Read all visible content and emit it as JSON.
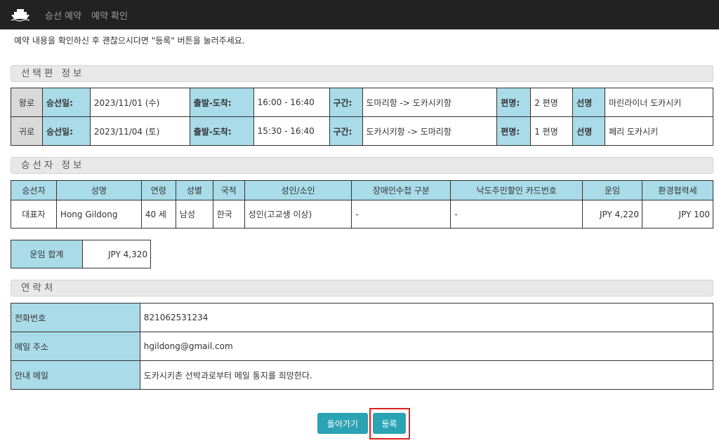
{
  "nav": {
    "items": [
      "승선 예약",
      "예약 확인"
    ]
  },
  "intro": "예약 내용을 확인하신 후 괜찮으시다면 \"등록\" 버튼을 눌러주세요.",
  "sections": {
    "trip": "선택편 정보",
    "passengers": "승선자 정보",
    "contact": "연락처"
  },
  "trips": [
    {
      "dir": "왕로",
      "date_label": "승선일:",
      "date": "2023/11/01 (수)",
      "time_label": "출발-도착:",
      "time": "16:00 - 16:40",
      "route_label": "구간:",
      "route": "도마리항 -> 도카시키항",
      "count_label": "편명:",
      "count": "2 편명",
      "ship_label": "선명",
      "ship": "마린라이너 도카시키"
    },
    {
      "dir": "귀로",
      "date_label": "승선일:",
      "date": "2023/11/04 (토)",
      "time_label": "출발-도착:",
      "time": "15:30 - 16:40",
      "route_label": "구간:",
      "route": "도카시키항 -> 도마리항",
      "count_label": "편명:",
      "count": "1 편명",
      "ship_label": "선명",
      "ship": "페리 도카시키"
    }
  ],
  "passenger_table": {
    "headers": [
      "승선자",
      "성명",
      "연령",
      "성별",
      "국적",
      "성인/소인",
      "장애인수첩 구분",
      "낙도주민할인 카드번호",
      "운임",
      "환경협력세"
    ],
    "rows": [
      [
        "대표자",
        "Hong Gildong",
        "40 세",
        "남성",
        "한국",
        "성인(고교생 이상)",
        "-",
        "-",
        "JPY 4,220",
        "JPY 100"
      ]
    ]
  },
  "total": {
    "label": "운임 합계",
    "value": "JPY 4,320"
  },
  "contact": [
    {
      "label": "전화번호",
      "value": "821062531234"
    },
    {
      "label": "메일 주소",
      "value": "hgildong@gmail.com"
    },
    {
      "label": "안내 메일",
      "value": "도카시키촌 선박과로부터 메일 통지를 희망한다."
    }
  ],
  "buttons": {
    "back": "돌아가기",
    "register": "등록"
  },
  "colors": {
    "accent": "#2aa3b4",
    "label_bg": "#a9dbe8",
    "highlight": "#e02020",
    "navbar": "#222222"
  }
}
